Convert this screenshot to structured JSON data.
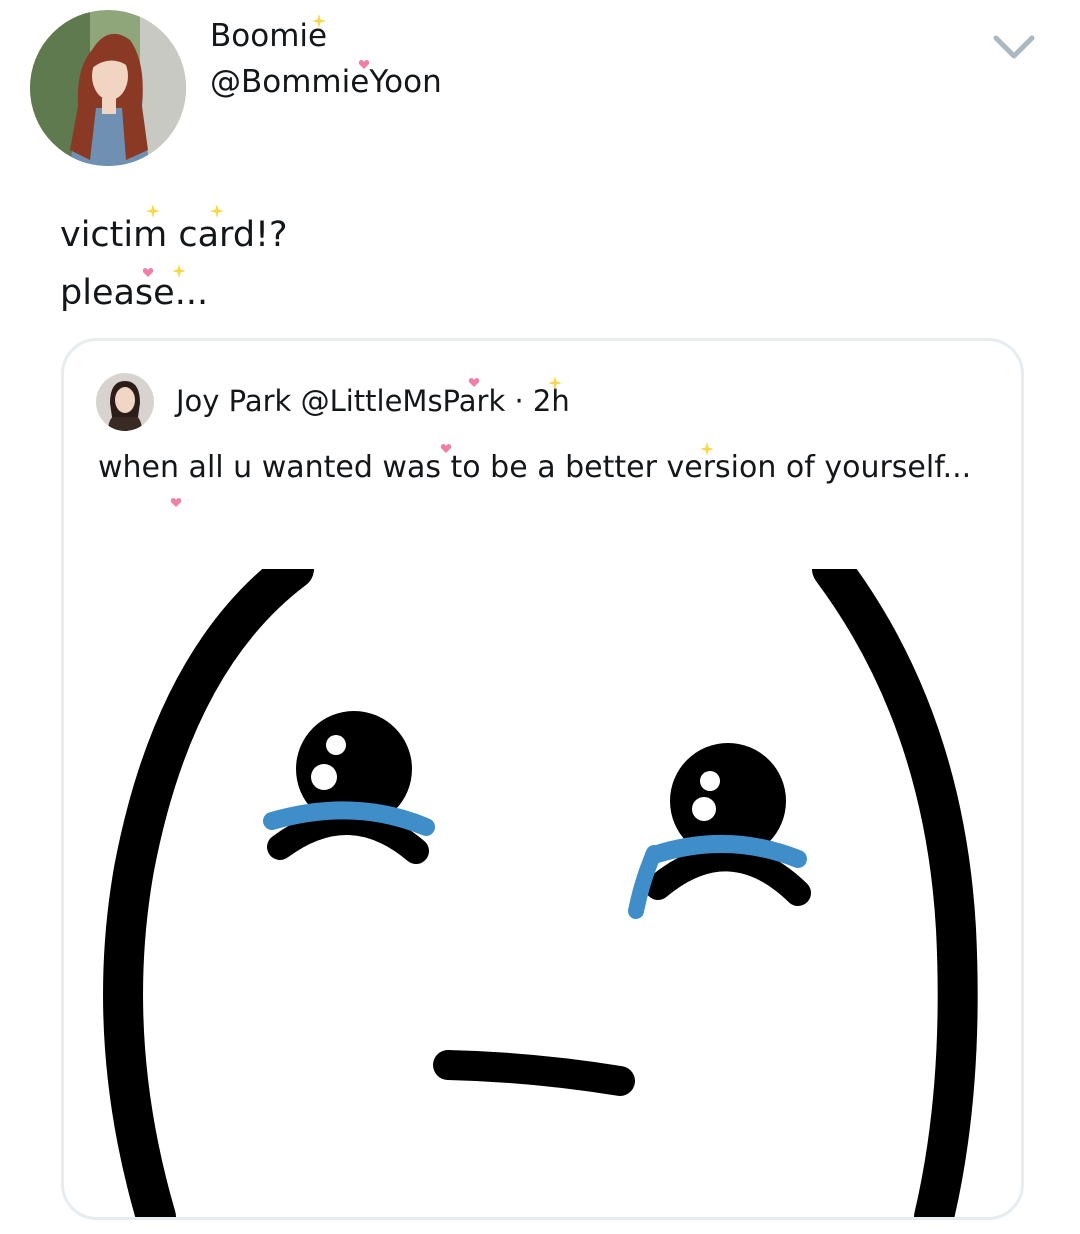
{
  "tweet": {
    "author": {
      "display_name": "Boomie",
      "handle": "@BommieYoon",
      "avatar_icon": "user-avatar-photo"
    },
    "menu_icon": "chevron-down-icon",
    "text_lines": [
      "victim card!?",
      "please..."
    ],
    "quoted_tweet": {
      "display_name": "Joy Park",
      "handle": "@LittleMsPark",
      "separator": "·",
      "time": "2h",
      "avatar_icon": "quoted-user-avatar-photo",
      "text": "when all u wanted was to be a better version of yourself...",
      "media": {
        "icon": "crying-face-meme-image",
        "tear_color": "#3f8ec9",
        "line_color": "#000000"
      }
    }
  },
  "colors": {
    "text": "#14171a",
    "card_border": "#e6ecf0",
    "chevron": "#aab8c2",
    "sparkle_yellow": "#f6d84a",
    "sparkle_pink": "#f07ea8"
  }
}
